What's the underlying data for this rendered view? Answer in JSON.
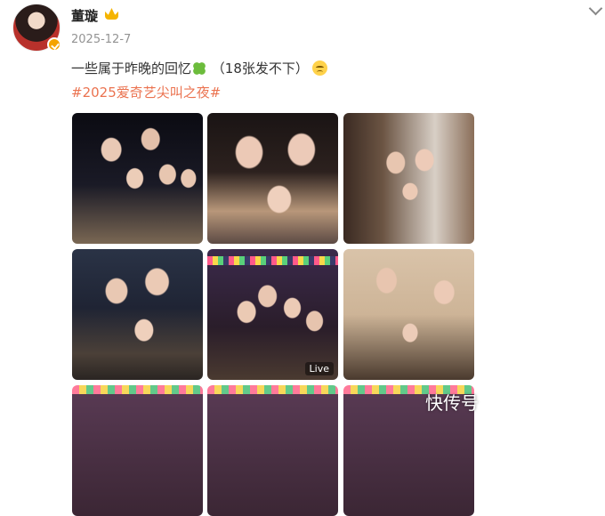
{
  "post": {
    "author": "董璇",
    "date": "2025-12-7",
    "text_main": "一些属于昨晚的回忆",
    "text_note": "（18张发不下）",
    "hashtag": "#2025爱奇艺尖叫之夜#"
  },
  "photos": {
    "live_label": "Live"
  },
  "watermark": "快传号",
  "icons": {
    "avatar_badge": "verified-badge-icon",
    "crown": "crown-icon",
    "more": "chevron-down-icon",
    "clover": "clover-emoji-icon",
    "sad": "sad-face-emoji-icon"
  },
  "colors": {
    "hashtag": "#eb7350",
    "date": "#939393",
    "badge": "#f4a300"
  }
}
